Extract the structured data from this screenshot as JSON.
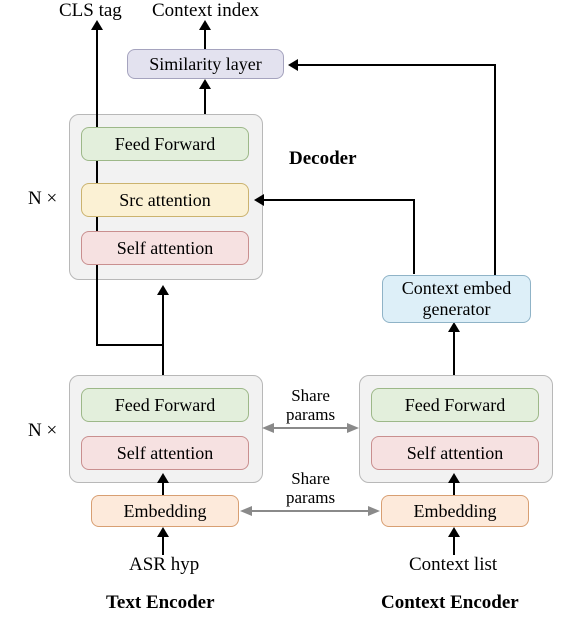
{
  "outputs": {
    "cls_tag": "CLS tag",
    "context_index": "Context index"
  },
  "layers": {
    "similarity": "Similarity layer",
    "feed_forward": "Feed Forward",
    "src_attention": "Src attention",
    "self_attention": "Self attention",
    "embedding": "Embedding",
    "context_embed_gen": "Context embed\ngenerator"
  },
  "section_labels": {
    "decoder": "Decoder",
    "text_encoder": "Text Encoder",
    "context_encoder": "Context Encoder",
    "n_times": "N ×"
  },
  "inputs": {
    "asr_hyp": "ASR hyp",
    "context_list": "Context list"
  },
  "annotations": {
    "share_params_1": "Share\nparams",
    "share_params_2": "Share\nparams"
  }
}
